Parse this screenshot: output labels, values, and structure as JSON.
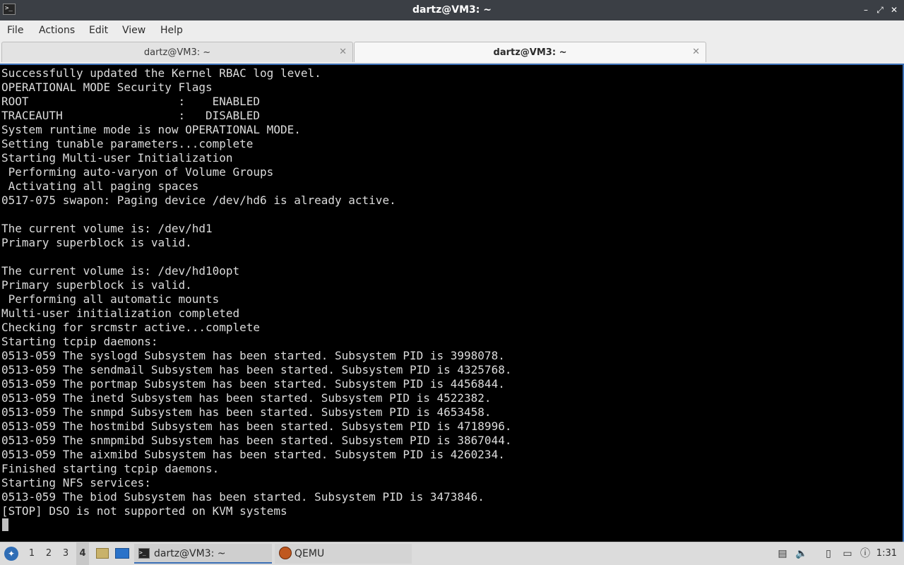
{
  "window": {
    "title": "dartz@VM3: ~",
    "icon": "terminal-icon",
    "controls": {
      "minimize": "–",
      "maximize": "⤢",
      "close": "✕"
    }
  },
  "menu": [
    "File",
    "Actions",
    "Edit",
    "View",
    "Help"
  ],
  "tabs": [
    {
      "label": "dartz@VM3: ~",
      "close": "✕",
      "active": false
    },
    {
      "label": "dartz@VM3: ~",
      "close": "✕",
      "active": true
    }
  ],
  "terminal": {
    "lines": [
      "Successfully updated the Kernel RBAC log level.",
      "OPERATIONAL MODE Security Flags",
      "ROOT                      :    ENABLED",
      "TRACEAUTH                 :   DISABLED",
      "System runtime mode is now OPERATIONAL MODE.",
      "Setting tunable parameters...complete",
      "Starting Multi-user Initialization",
      " Performing auto-varyon of Volume Groups",
      " Activating all paging spaces",
      "0517-075 swapon: Paging device /dev/hd6 is already active.",
      "",
      "The current volume is: /dev/hd1",
      "Primary superblock is valid.",
      "",
      "The current volume is: /dev/hd10opt",
      "Primary superblock is valid.",
      " Performing all automatic mounts",
      "Multi-user initialization completed",
      "Checking for srcmstr active...complete",
      "Starting tcpip daemons:",
      "0513-059 The syslogd Subsystem has been started. Subsystem PID is 3998078.",
      "0513-059 The sendmail Subsystem has been started. Subsystem PID is 4325768.",
      "0513-059 The portmap Subsystem has been started. Subsystem PID is 4456844.",
      "0513-059 The inetd Subsystem has been started. Subsystem PID is 4522382.",
      "0513-059 The snmpd Subsystem has been started. Subsystem PID is 4653458.",
      "0513-059 The hostmibd Subsystem has been started. Subsystem PID is 4718996.",
      "0513-059 The snmpmibd Subsystem has been started. Subsystem PID is 3867044.",
      "0513-059 The aixmibd Subsystem has been started. Subsystem PID is 4260234.",
      "Finished starting tcpip daemons.",
      "Starting NFS services:",
      "0513-059 The biod Subsystem has been started. Subsystem PID is 3473846.",
      "[STOP] DSO is not supported on KVM systems"
    ],
    "background": "#000000",
    "foreground": "#dcdcdc"
  },
  "taskbar": {
    "workspaces": [
      "1",
      "2",
      "3",
      "4"
    ],
    "active_workspace": "4",
    "tasks": [
      {
        "label": "dartz@VM3: ~",
        "icon": "terminal-icon",
        "active": true
      },
      {
        "label": "QEMU",
        "icon": "qemu-icon",
        "active": false
      }
    ],
    "tray_icons": [
      "clipboard-icon",
      "volume-icon",
      "file-manager-icon",
      "display-icon",
      "update-notifier-icon"
    ],
    "clock": "1:31"
  },
  "colors": {
    "titlebar": "#3b3f45",
    "accent": "#3b6fb5"
  }
}
